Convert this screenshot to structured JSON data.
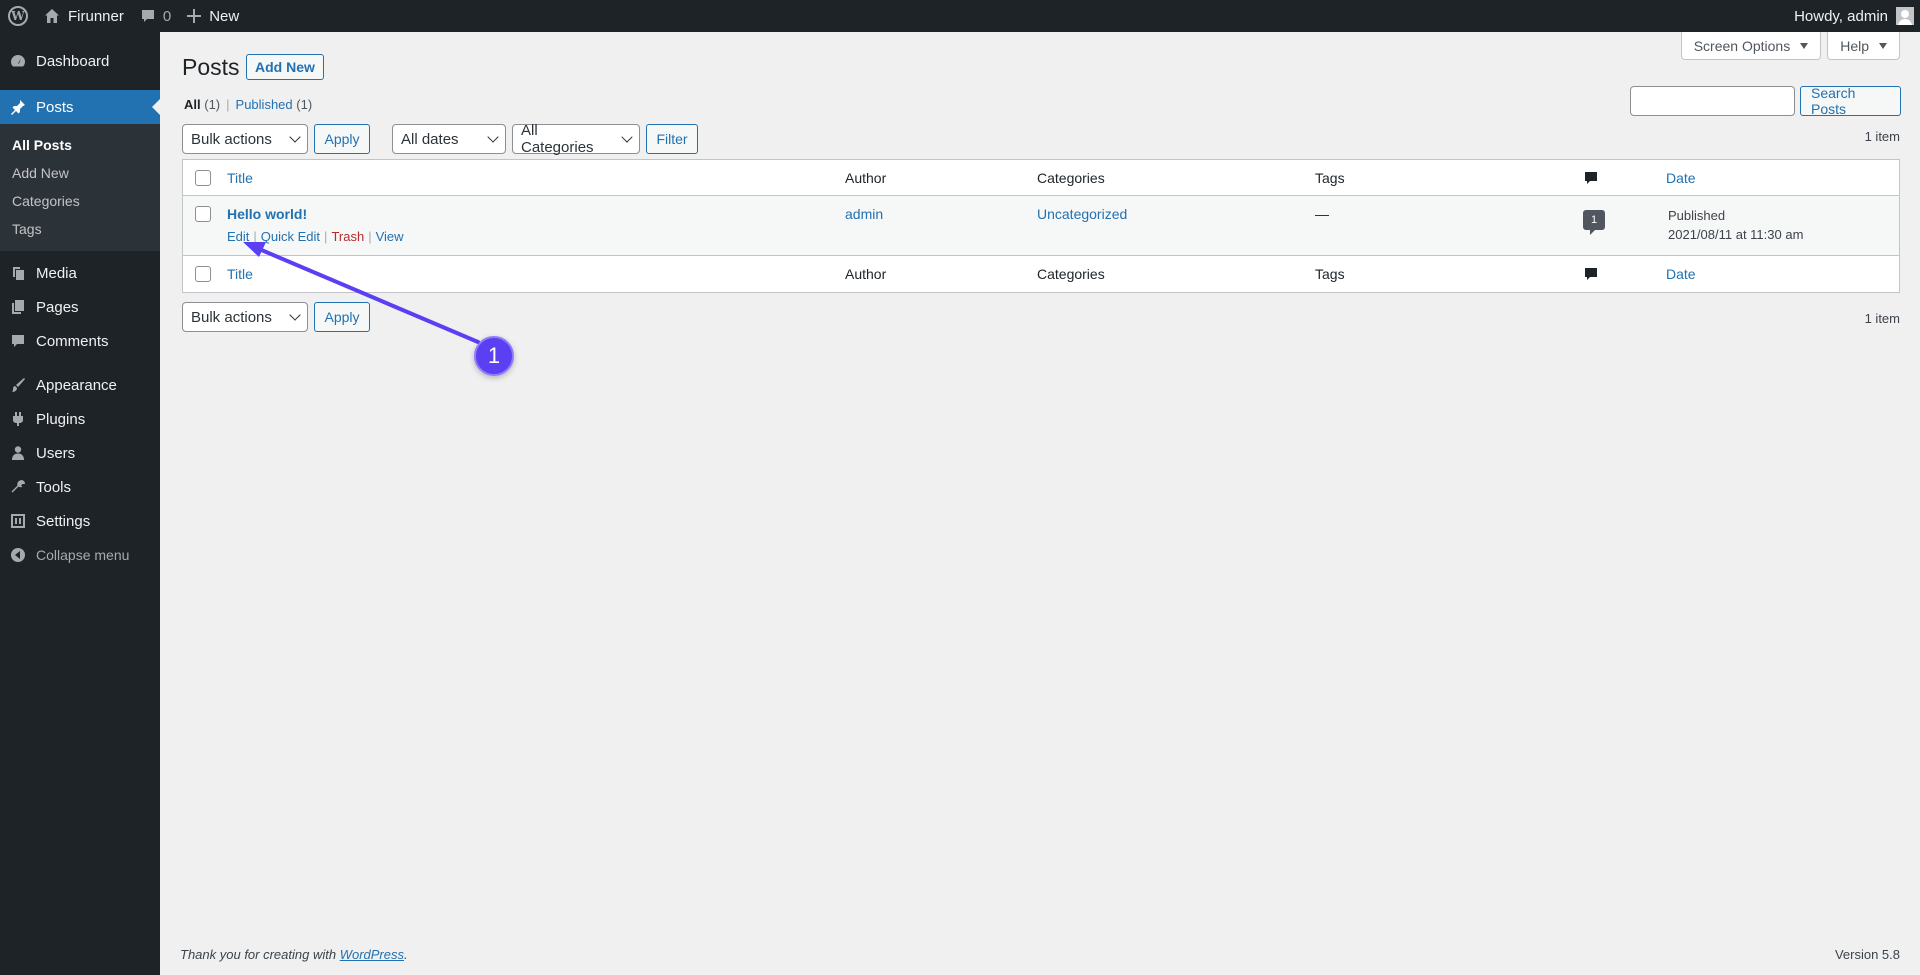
{
  "adminbar": {
    "site_name": "Firunner",
    "comments_count": "0",
    "new_label": "New",
    "howdy": "Howdy, admin"
  },
  "sidebar": {
    "items": [
      {
        "label": "Dashboard",
        "icon": "dashboard-icon"
      },
      {
        "label": "Posts",
        "icon": "pin-icon"
      },
      {
        "label": "Media",
        "icon": "media-icon"
      },
      {
        "label": "Pages",
        "icon": "pages-icon"
      },
      {
        "label": "Comments",
        "icon": "comments-icon"
      },
      {
        "label": "Appearance",
        "icon": "brush-icon"
      },
      {
        "label": "Plugins",
        "icon": "plugin-icon"
      },
      {
        "label": "Users",
        "icon": "users-icon"
      },
      {
        "label": "Tools",
        "icon": "wrench-icon"
      },
      {
        "label": "Settings",
        "icon": "settings-icon"
      }
    ],
    "posts_submenu": [
      "All Posts",
      "Add New",
      "Categories",
      "Tags"
    ],
    "collapse_label": "Collapse menu"
  },
  "header": {
    "screen_options": "Screen Options",
    "help": "Help",
    "title": "Posts",
    "add_new": "Add New"
  },
  "views": {
    "all": "All",
    "all_count": "(1)",
    "published": "Published",
    "published_count": "(1)"
  },
  "search": {
    "button": "Search Posts"
  },
  "filters": {
    "bulk_actions": "Bulk actions",
    "apply": "Apply",
    "dates": "All dates",
    "categories": "All Categories",
    "filter": "Filter",
    "item_count": "1 item"
  },
  "table": {
    "columns": {
      "title": "Title",
      "author": "Author",
      "categories": "Categories",
      "tags": "Tags",
      "date": "Date"
    },
    "rows": [
      {
        "title": "Hello world!",
        "author": "admin",
        "categories": "Uncategorized",
        "tags": "—",
        "comments": "1",
        "status": "Published",
        "date": "2021/08/11 at 11:30 am",
        "actions": {
          "edit": "Edit",
          "quick_edit": "Quick Edit",
          "trash": "Trash",
          "view": "View"
        }
      }
    ]
  },
  "footer": {
    "thanks_prefix": "Thank you for creating with",
    "thanks_link": "WordPress",
    "thanks_suffix": ".",
    "version": "Version 5.8"
  },
  "annotation": {
    "step": "1",
    "color": "#5b3ff3"
  }
}
